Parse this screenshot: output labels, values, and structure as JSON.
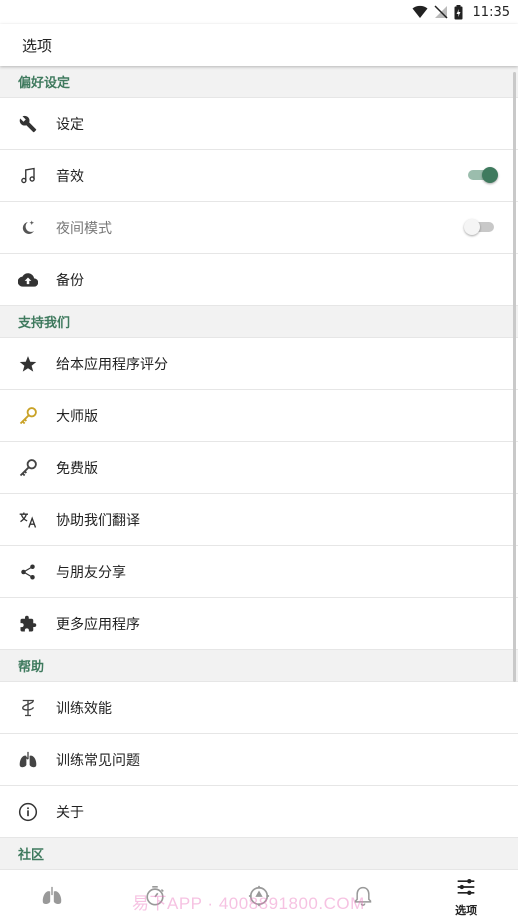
{
  "status_bar": {
    "time": "11:35"
  },
  "app_bar": {
    "title": "选项"
  },
  "sections": {
    "preferences": {
      "header": "偏好设定",
      "items": [
        {
          "label": "设定"
        },
        {
          "label": "音效",
          "toggle": true
        },
        {
          "label": "夜间模式",
          "toggle": false
        },
        {
          "label": "备份"
        }
      ]
    },
    "support": {
      "header": "支持我们",
      "items": [
        {
          "label": "给本应用程序评分"
        },
        {
          "label": "大师版"
        },
        {
          "label": "免费版"
        },
        {
          "label": "协助我们翻译"
        },
        {
          "label": "与朋友分享"
        },
        {
          "label": "更多应用程序"
        }
      ]
    },
    "help": {
      "header": "帮助",
      "items": [
        {
          "label": "训练效能"
        },
        {
          "label": "训练常见问题"
        },
        {
          "label": "关于"
        }
      ]
    },
    "community": {
      "header": "社区"
    }
  },
  "bottom_nav": {
    "options_label": "选项"
  },
  "watermark": "易下APP · 4008891800.COM",
  "colors": {
    "accent": "#3f7a5e",
    "gold": "#c9a227"
  }
}
